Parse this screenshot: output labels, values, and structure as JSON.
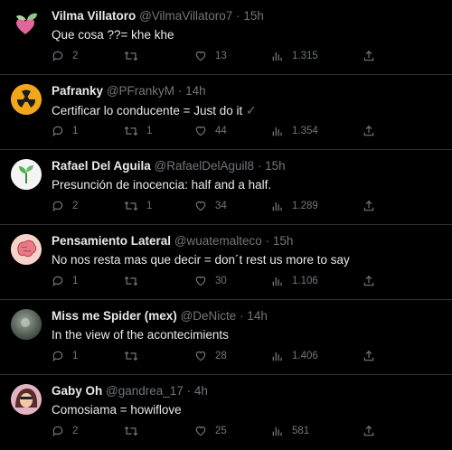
{
  "tweets": [
    {
      "name": "Vilma Villatoro",
      "handle": "@VilmaVillatoro7",
      "time": "15h",
      "text": "Que cosa ??= khe khe",
      "replies": "2",
      "retweets": "",
      "likes": "13",
      "views": "1.315",
      "avatar": "pink-green-heart-avatar"
    },
    {
      "name": "Pafranky",
      "handle": "@PFrankyM",
      "time": "14h",
      "text": "Certificar lo conducente = Just do it",
      "text_suffix": "✓",
      "replies": "1",
      "retweets": "1",
      "likes": "44",
      "views": "1.354",
      "avatar": "radioactive-symbol-avatar"
    },
    {
      "name": "Rafael Del Aguila",
      "handle": "@RafaelDelAguil8",
      "time": "15h",
      "text": "Presunción de inocencia: half and a half.",
      "replies": "2",
      "retweets": "1",
      "likes": "34",
      "views": "1.289",
      "avatar": "sprout-avatar"
    },
    {
      "name": "Pensamiento Lateral",
      "handle": "@wuatemalteco",
      "time": "15h",
      "text": "No nos resta mas que decir = don´t rest us more to say",
      "replies": "1",
      "retweets": "",
      "likes": "30",
      "views": "1.106",
      "avatar": "brain-avatar"
    },
    {
      "name": "Miss me Spider (mex)",
      "handle": "@DeNicte",
      "time": "14h",
      "text": "In the view of the acontecimients",
      "replies": "1",
      "retweets": "",
      "likes": "28",
      "views": "1.406",
      "avatar": "photo-avatar"
    },
    {
      "name": "Gaby Oh",
      "handle": "@gandrea_17",
      "time": "4h",
      "text": "Comosiama = howiflove",
      "replies": "2",
      "retweets": "",
      "likes": "25",
      "views": "581",
      "avatar": "portrait-avatar"
    }
  ],
  "separator": "·",
  "icons": [
    "reply-icon",
    "retweet-icon",
    "like-icon",
    "views-icon",
    "share-icon"
  ],
  "colors": {
    "background": "#000000",
    "text": "#e7e9ea",
    "muted": "#71767b",
    "border": "#2f3336"
  }
}
